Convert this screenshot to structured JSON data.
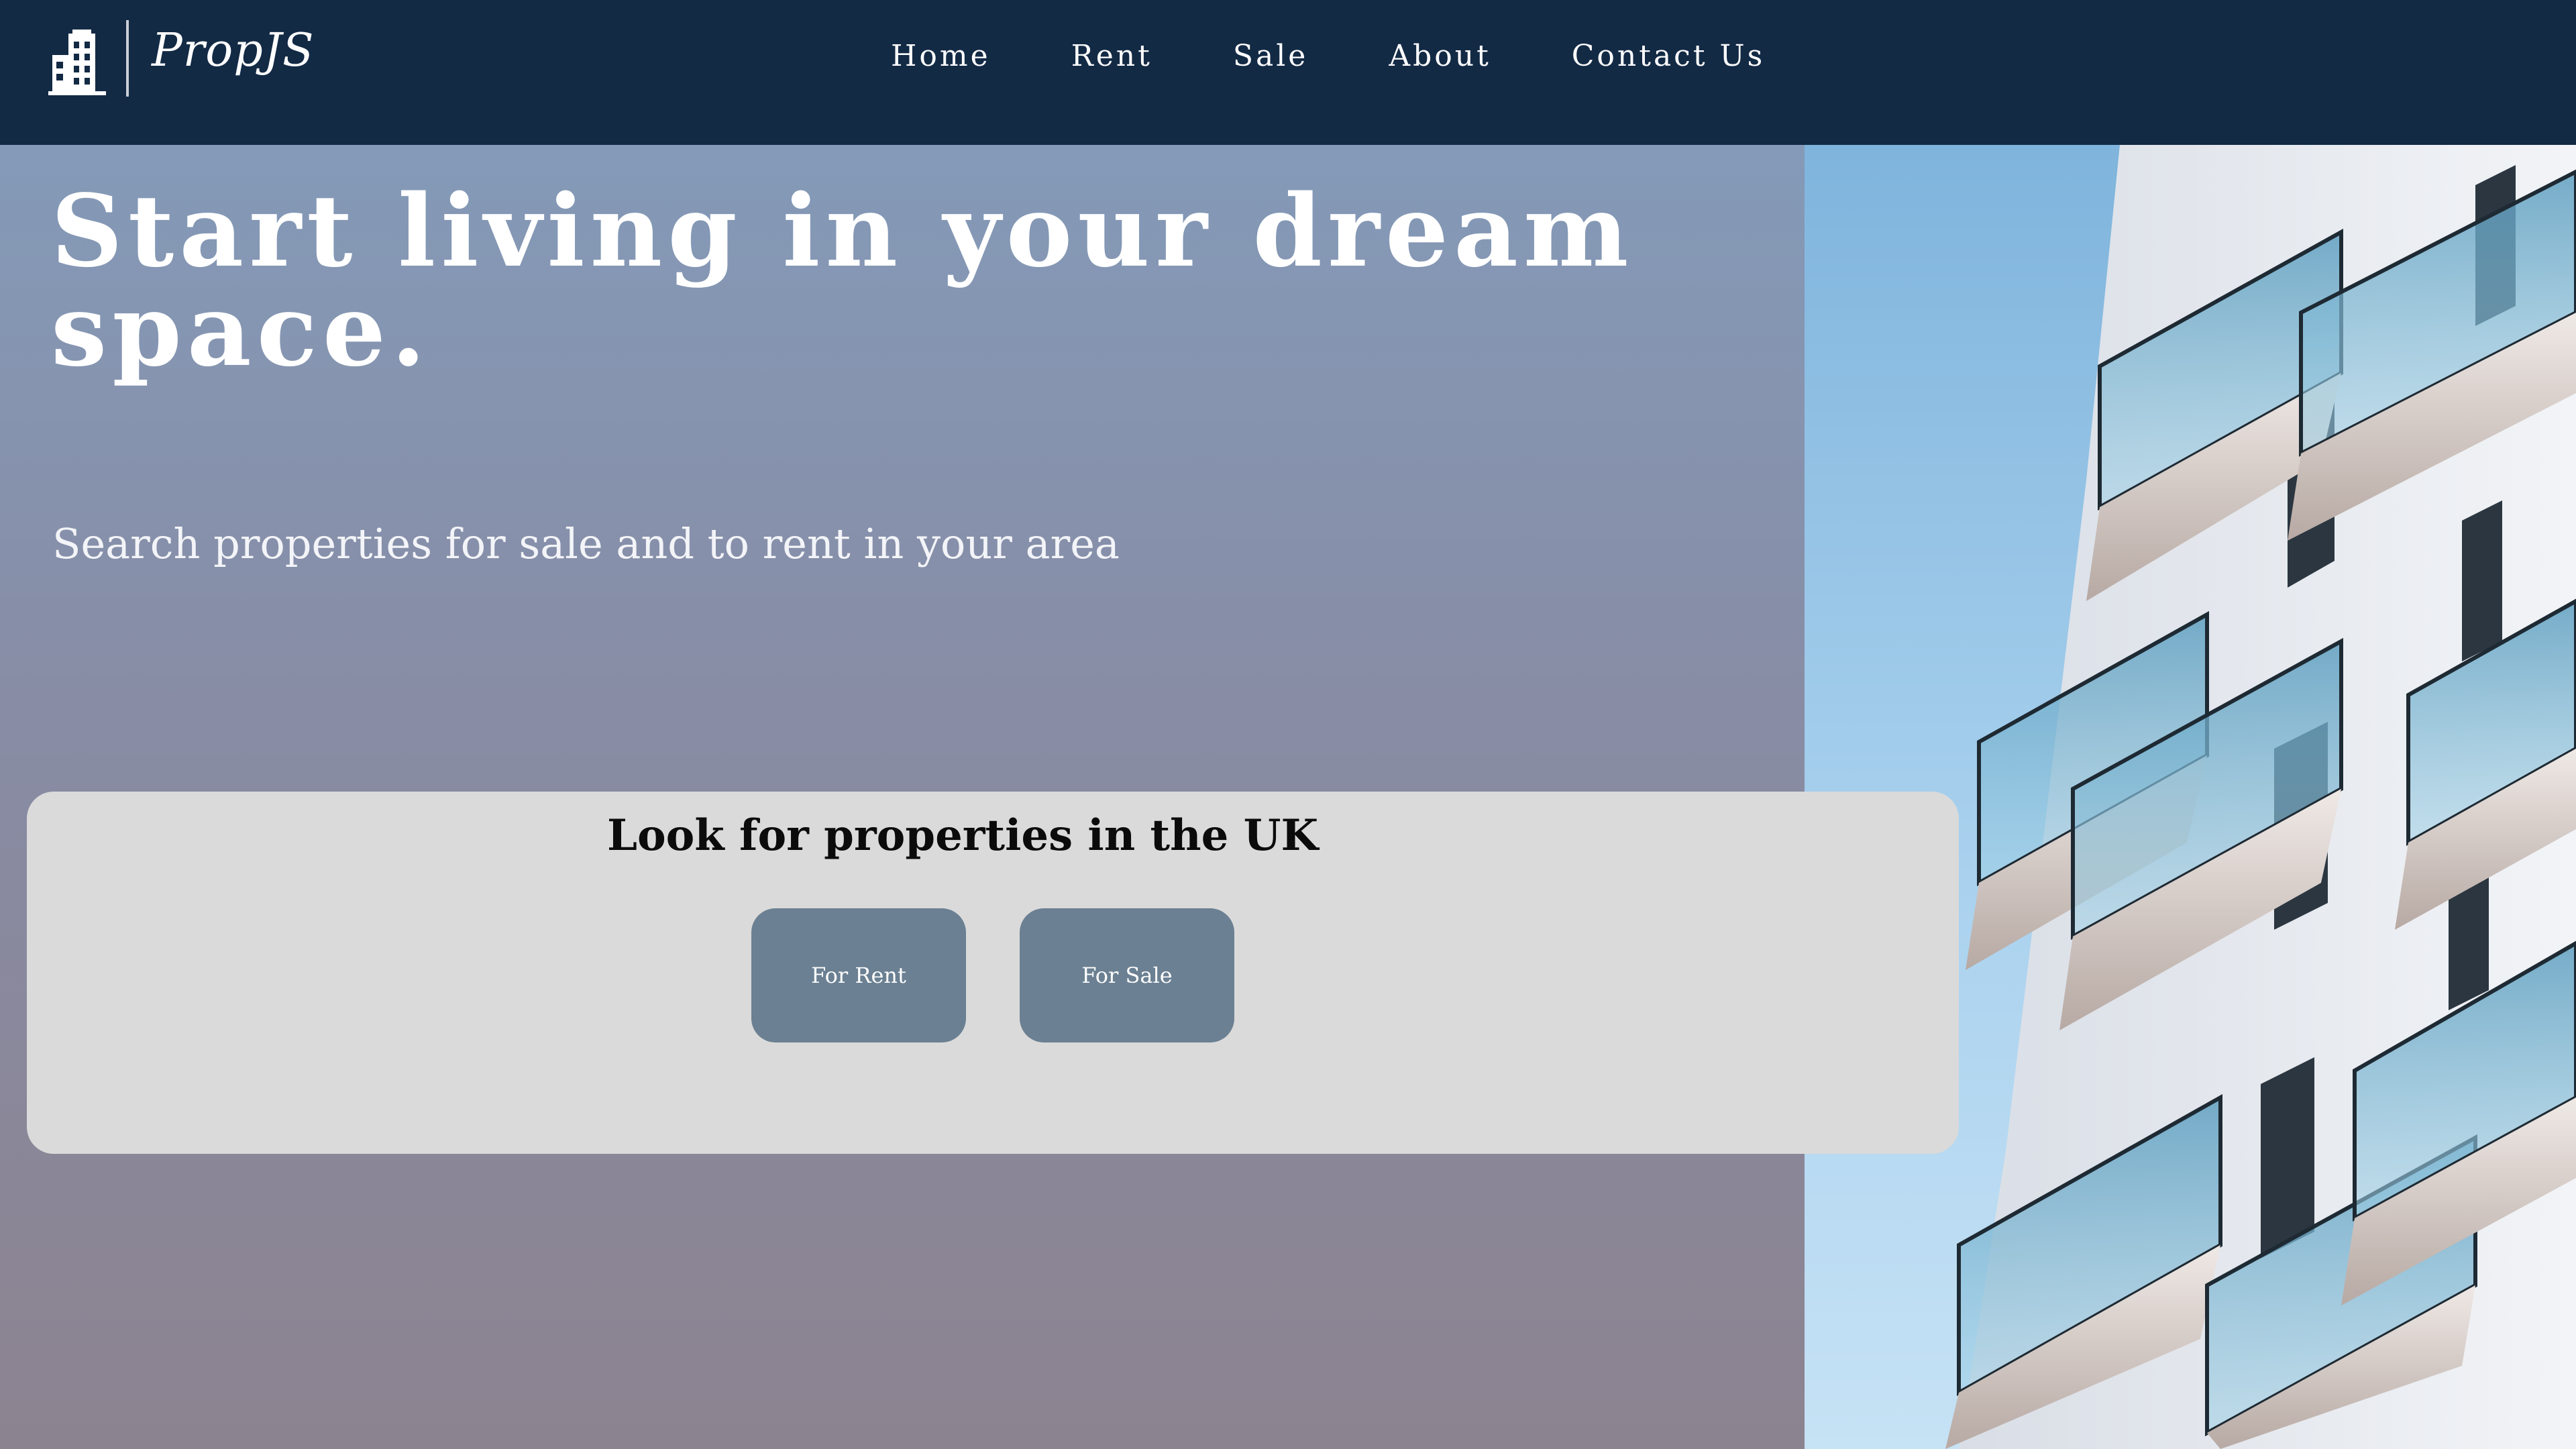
{
  "brand": {
    "name": "PropJS",
    "logo_icon": "building-icon"
  },
  "nav": {
    "items": [
      {
        "label": "Home"
      },
      {
        "label": "Rent"
      },
      {
        "label": "Sale"
      },
      {
        "label": "About"
      },
      {
        "label": "Contact Us"
      }
    ]
  },
  "hero": {
    "title": "Start living in your dream space.",
    "subtitle": "Search properties for sale and to rent in your area",
    "image": "apartment-building-photo"
  },
  "search": {
    "heading": "Look for properties in the UK",
    "buttons": [
      {
        "label": "For Rent"
      },
      {
        "label": "For Sale"
      }
    ]
  },
  "colors": {
    "navbar": "#132a45",
    "card": "#dadada",
    "button": "#6b8092",
    "sky": "#a9d1ee"
  }
}
